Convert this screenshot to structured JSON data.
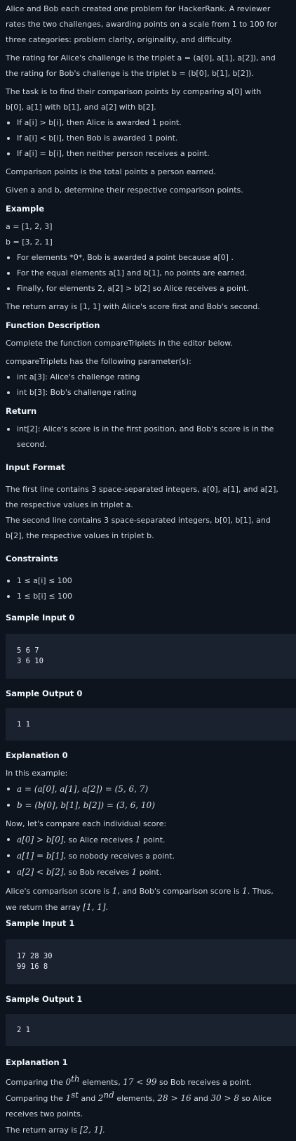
{
  "intro": {
    "p1": "Alice and Bob each created one problem for HackerRank. A reviewer rates the two challenges, awarding points on a scale from 1 to 100 for three categories: problem clarity, originality, and difficulty.",
    "p2": "The rating for Alice's challenge is the triplet a = (a[0], a[1], a[2]), and the rating for Bob's challenge is the triplet b = (b[0], b[1], b[2]).",
    "p3": "The task is to find their comparison points by comparing a[0] with b[0], a[1] with b[1], and a[2] with b[2].",
    "rules": [
      "If a[i] > b[i], then Alice is awarded 1 point.",
      "If a[i] < b[i], then Bob is awarded 1 point.",
      "If a[i] = b[i], then neither person receives a point."
    ],
    "p4": "Comparison points is the total points a person earned.",
    "p5": "Given a and b, determine their respective comparison points."
  },
  "example": {
    "heading": "Example",
    "a": "a = [1, 2, 3]",
    "b": "b = [3, 2, 1]",
    "items": [
      "For elements *0*, Bob is awarded a point because a[0] .",
      "For the equal elements a[1] and b[1], no points are earned.",
      "Finally, for elements 2, a[2] > b[2] so Alice receives a point."
    ],
    "result": "The return array is [1, 1] with Alice's score first and Bob's second."
  },
  "function_description": {
    "heading": "Function Description",
    "p1": "Complete the function compareTriplets in the editor below.",
    "p2": "compareTriplets has the following parameter(s):",
    "params": [
      "int a[3]: Alice's challenge rating",
      "int b[3]: Bob's challenge rating"
    ]
  },
  "return_section": {
    "heading": "Return",
    "items": [
      "int[2]: Alice's score is in the first position, and Bob's score is in the second."
    ]
  },
  "input_format": {
    "heading": "Input Format",
    "p1": "The first line contains 3 space-separated integers, a[0], a[1], and a[2], the respective values in triplet a.",
    "p2": "The second line contains 3 space-separated integers, b[0], b[1], and b[2], the respective values in triplet b."
  },
  "constraints": {
    "heading": "Constraints",
    "items": [
      "1 ≤ a[i] ≤ 100",
      "1 ≤ b[i] ≤ 100"
    ]
  },
  "sample_input_0": {
    "heading": "Sample Input 0",
    "lines": [
      "5 6 7",
      "3 6 10"
    ]
  },
  "sample_output_0": {
    "heading": "Sample Output 0",
    "lines": [
      "1 1"
    ]
  },
  "explanation_0": {
    "heading": "Explanation 0",
    "intro": "In this example:",
    "math_a": "a = (a[0], a[1], a[2]) = (5, 6, 7)",
    "math_b": "b = (b[0], b[1], b[2]) = (3, 6, 10)",
    "compare": "Now, let's compare each individual score:",
    "items": [
      {
        "math": "a[0] > b[0]",
        "text": ", so Alice receives ",
        "num": "1",
        "tail": " point."
      },
      {
        "math": "a[1] = b[1]",
        "text": ", so nobody receives a point.",
        "num": "",
        "tail": ""
      },
      {
        "math": "a[2] < b[2]",
        "text": ", so Bob receives ",
        "num": "1",
        "tail": " point."
      }
    ],
    "summary_pre": "Alice's comparison score is ",
    "summary_num1": "1",
    "summary_mid": ", and Bob's comparison score is ",
    "summary_num2": "1",
    "summary_post": ". Thus, we return the array ",
    "summary_arr": "[1, 1]",
    "summary_end": "."
  },
  "sample_input_1": {
    "heading": "Sample Input 1",
    "lines": [
      "17 28 30",
      "99 16 8"
    ]
  },
  "sample_output_1": {
    "heading": "Sample Output 1",
    "lines": [
      "2 1"
    ]
  },
  "explanation_1": {
    "heading": "Explanation 1",
    "l1_pre": "Comparing the ",
    "l1_math": "0",
    "l1_sup": "th",
    "l1_mid": " elements, ",
    "l1_cmp": "17 < 99",
    "l1_post": " so Bob receives a point.",
    "l2_pre": "Comparing the ",
    "l2_m1": "1",
    "l2_s1": "st",
    "l2_and": " and ",
    "l2_m2": "2",
    "l2_s2": "nd",
    "l2_mid": " elements, ",
    "l2_c1": "28 > 16",
    "l2_and2": " and ",
    "l2_c2": "30 > 8",
    "l2_post": " so Alice receives two points.",
    "l3_pre": "The return array is ",
    "l3_arr": "[2, 1]",
    "l3_end": "."
  }
}
